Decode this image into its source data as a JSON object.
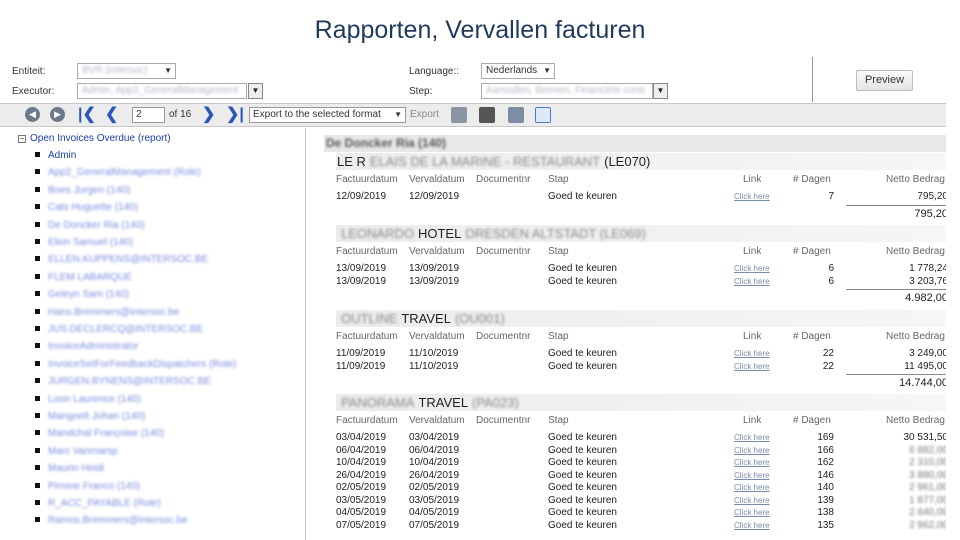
{
  "slide_title": "Rapporten, Vervallen facturen",
  "params": {
    "entiteit_label": "Entiteit:",
    "entiteit_value": "BVR (Intersoc)",
    "executor_label": "Executor:",
    "executor_value": "Admin, App2_GeneralManagement",
    "language_label": "Language::",
    "language_value": "Nederlands",
    "step_label": "Step:",
    "step_value": "Aanvullen, Beeven, Financiële contr",
    "preview_label": "Preview"
  },
  "toolbar": {
    "page_value": "2",
    "of_pages": "of 16",
    "export_format": "Export to the selected format",
    "export_label": "Export"
  },
  "tree": {
    "root": "Open Invoices Overdue (report)",
    "items": [
      "Admin",
      "App2_GeneralManagement (Role)",
      "Boes Jurgen (140)",
      "Cats Huguette (140)",
      "De Doncker Ria (140)",
      "Elion Samuel (140)",
      "ELLEN.KUPPENS@INTERSOC.BE",
      "FLEM LABARQUE",
      "Geleyn Sam (140)",
      "Hans.Bremmers@intersoc.be",
      "JUS.DECLERCQ@INTERSOC.BE",
      "InvoiceAdministrator",
      "InvoiceSetForFeedbackDispatchers (Role)",
      "JURGEN.BYNENS@INTERSOC.BE",
      "Loon Laurence (140)",
      "Mangoelt Johan (140)",
      "Mandchal Françoise (140)",
      "Marc Vanmarsp",
      "Maurin Heidi",
      "Pirrone Franco (140)",
      "R_ACC_PAYABLE (Role)",
      "Ramos.Bremmers@intersoc.be"
    ]
  },
  "report": {
    "group_header": "De Doncker Ria (140)",
    "columns": [
      "Factuurdatum",
      "Vervaldatum",
      "Documentnr",
      "Stap",
      "Link",
      "# Dagen",
      "Netto Bedrag"
    ],
    "customers": [
      {
        "name_prefix": "LE R",
        "name_blur": "ELAIS DE LA MARINE - RESTAURANT",
        "name_suffix": "(LE070)",
        "rows": [
          {
            "factuurdatum": "12/09/2019",
            "vervaldatum": "12/09/2019",
            "documentnr": "",
            "stap": "Goed te keuren",
            "link": "Click here",
            "dagen": "7",
            "bedrag": "795,20"
          }
        ],
        "total": "795,20"
      },
      {
        "name_prefix": "",
        "name_blur": "LEONARDO",
        "name_suffix": "HOTEL",
        "name_blur2": "DRESDEN ALTSTADT (LE069)",
        "rows": [
          {
            "factuurdatum": "13/09/2019",
            "vervaldatum": "13/09/2019",
            "documentnr": "",
            "stap": "Goed te keuren",
            "link": "Click here",
            "dagen": "6",
            "bedrag": "1 778,24"
          },
          {
            "factuurdatum": "13/09/2019",
            "vervaldatum": "13/09/2019",
            "documentnr": "",
            "stap": "Goed te keuren",
            "link": "Click here",
            "dagen": "6",
            "bedrag": "3 203,76"
          }
        ],
        "total": "4.982,00"
      },
      {
        "name_prefix": "",
        "name_blur": "OUTLINE",
        "name_suffix": "TRAVEL",
        "name_blur2": "(OU001)",
        "rows": [
          {
            "factuurdatum": "11/09/2019",
            "vervaldatum": "11/10/2019",
            "documentnr": "",
            "stap": "Goed te keuren",
            "link": "Click here",
            "dagen": "22",
            "bedrag": "3 249,00"
          },
          {
            "factuurdatum": "11/09/2019",
            "vervaldatum": "11/10/2019",
            "documentnr": "",
            "stap": "Goed te keuren",
            "link": "Click here",
            "dagen": "22",
            "bedrag": "11 495,00"
          }
        ],
        "total": "14.744,00"
      },
      {
        "name_prefix": "",
        "name_blur": "PANORAMA",
        "name_suffix": "TRAVEL",
        "name_blur2": "(PA023)",
        "rows": [
          {
            "factuurdatum": "03/04/2019",
            "vervaldatum": "03/04/2019",
            "documentnr": "",
            "stap": "Goed te keuren",
            "link": "Click here",
            "dagen": "169",
            "bedrag": "30 531,50"
          },
          {
            "factuurdatum": "06/04/2019",
            "vervaldatum": "06/04/2019",
            "documentnr": "",
            "stap": "Goed te keuren",
            "link": "Click here",
            "dagen": "166",
            "bedrag": "6 882,00"
          },
          {
            "factuurdatum": "10/04/2019",
            "vervaldatum": "10/04/2019",
            "documentnr": "",
            "stap": "Goed te keuren",
            "link": "Click here",
            "dagen": "162",
            "bedrag": "2 310,00"
          },
          {
            "factuurdatum": "26/04/2019",
            "vervaldatum": "26/04/2019",
            "documentnr": "",
            "stap": "Goed te keuren",
            "link": "Click here",
            "dagen": "146",
            "bedrag": "3 880,00"
          },
          {
            "factuurdatum": "02/05/2019",
            "vervaldatum": "02/05/2019",
            "documentnr": "",
            "stap": "Goed te keuren",
            "link": "Click here",
            "dagen": "140",
            "bedrag": "2 961,00"
          },
          {
            "factuurdatum": "03/05/2019",
            "vervaldatum": "03/05/2019",
            "documentnr": "",
            "stap": "Goed te keuren",
            "link": "Click here",
            "dagen": "139",
            "bedrag": "1 877,00"
          },
          {
            "factuurdatum": "04/05/2019",
            "vervaldatum": "04/05/2019",
            "documentnr": "",
            "stap": "Goed te keuren",
            "link": "Click here",
            "dagen": "138",
            "bedrag": "2 640,00"
          },
          {
            "factuurdatum": "07/05/2019",
            "vervaldatum": "07/05/2019",
            "documentnr": "",
            "stap": "Goed te keuren",
            "link": "Click here",
            "dagen": "135",
            "bedrag": "2 962,00"
          }
        ],
        "total": ""
      }
    ]
  }
}
